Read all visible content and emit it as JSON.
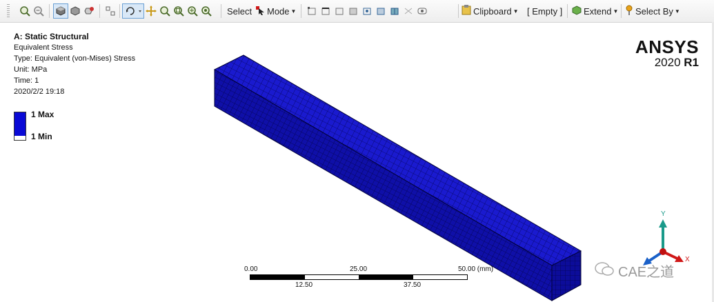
{
  "toolbar": {
    "select_label": "Select",
    "mode_label": "Mode",
    "clipboard_label": "Clipboard",
    "empty_label": "[ Empty ]",
    "extend_label": "Extend",
    "select_by_label": "Select By"
  },
  "result_info": {
    "title": "A: Static Structural",
    "result_name": "Equivalent Stress",
    "type": "Type: Equivalent (von-Mises) Stress",
    "unit": "Unit: MPa",
    "time": "Time: 1",
    "date": "2020/2/2 19:18"
  },
  "legend": {
    "max_label": "1 Max",
    "min_label": "1 Min",
    "color": "#0a0ad6"
  },
  "branding": {
    "name": "ANSYS",
    "version": "2020",
    "release": "R1"
  },
  "scale_bar": {
    "top_labels": [
      "0.00",
      "25.00",
      "50.00 (mm)"
    ],
    "bottom_labels": [
      "12.50",
      "37.50"
    ]
  },
  "triad": {
    "y_label": "Y",
    "x_label": "X",
    "y_color": "#1a9a8a",
    "x_color": "#d01818",
    "z_color": "#1a60c8"
  },
  "watermark": {
    "text": "CAE之道"
  }
}
